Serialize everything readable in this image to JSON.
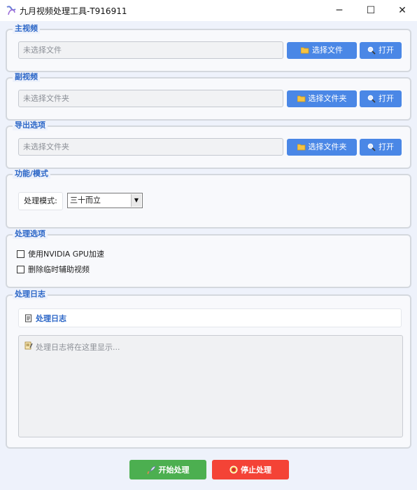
{
  "window": {
    "title": "九月视频处理工具-T916911",
    "minimize_glyph": "─",
    "maximize_glyph": "☐",
    "close_glyph": "✕"
  },
  "main_video": {
    "legend": "主视频",
    "placeholder": "未选择文件",
    "select_label": "选择文件",
    "open_label": "打开"
  },
  "sub_video": {
    "legend": "副视频",
    "placeholder": "未选择文件夹",
    "select_label": "选择文件夹",
    "open_label": "打开"
  },
  "export": {
    "legend": "导出选项",
    "placeholder": "未选择文件夹",
    "select_label": "选择文件夹",
    "open_label": "打开"
  },
  "function": {
    "legend": "功能/模式",
    "mode_label": "处理模式:",
    "mode_value": "三十而立"
  },
  "options": {
    "legend": "处理选项",
    "gpu_label": "使用NVIDIA GPU加速",
    "gpu_checked": false,
    "delete_temp_label": "删除临时辅助视频",
    "delete_temp_checked": false
  },
  "log": {
    "legend": "处理日志",
    "header": "处理日志",
    "placeholder": "处理日志将在这里显示..."
  },
  "actions": {
    "start_label": "开始处理",
    "stop_label": "停止处理"
  },
  "colors": {
    "accent": "#4a87e6",
    "legend_text": "#2b66c7",
    "start": "#4caf50",
    "stop": "#f44336",
    "background": "#eef2fb"
  },
  "icons": {
    "folder": "folder-icon",
    "open": "magnifier-icon",
    "log": "document-icon",
    "log_placeholder": "memo-icon",
    "start": "rocket-icon",
    "stop": "stop-icon"
  }
}
